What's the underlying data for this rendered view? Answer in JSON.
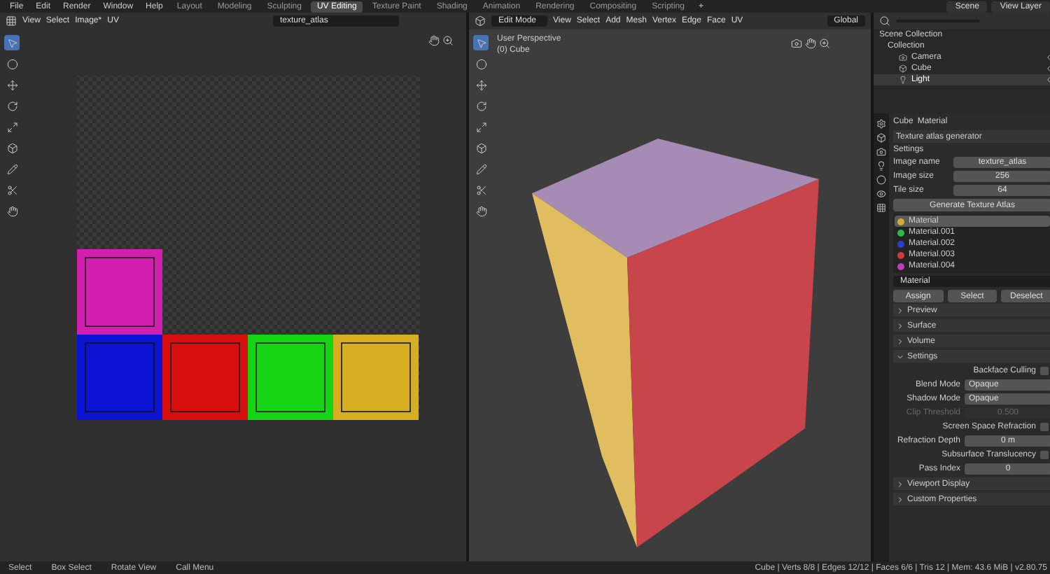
{
  "menu": [
    "File",
    "Edit",
    "Render",
    "Window",
    "Help"
  ],
  "workspaces": [
    {
      "label": "Layout",
      "selected": false
    },
    {
      "label": "Modeling",
      "selected": false
    },
    {
      "label": "Sculpting",
      "selected": false
    },
    {
      "label": "UV Editing",
      "selected": true
    },
    {
      "label": "Texture Paint",
      "selected": false
    },
    {
      "label": "Shading",
      "selected": false
    },
    {
      "label": "Animation",
      "selected": false
    },
    {
      "label": "Rendering",
      "selected": false
    },
    {
      "label": "Compositing",
      "selected": false
    },
    {
      "label": "Scripting",
      "selected": false
    }
  ],
  "add_workspace": "+",
  "scene": "Scene",
  "view_layer": "View Layer",
  "uv_editor": {
    "menus": [
      "View",
      "Select",
      "Image*",
      "UV"
    ],
    "image": "texture_atlas"
  },
  "viewport": {
    "mode": "Edit Mode",
    "menus": [
      "View",
      "Select",
      "Add",
      "Mesh",
      "Vertex",
      "Edge",
      "Face",
      "UV"
    ],
    "orientation": "Global",
    "perspective": "User Perspective",
    "object": "(0) Cube"
  },
  "outliner": {
    "root": "Scene Collection",
    "items": [
      {
        "label": "Collection",
        "children": [
          {
            "label": "Camera",
            "selected": false
          },
          {
            "label": "Cube",
            "selected": false
          },
          {
            "label": "Light",
            "selected": true
          }
        ]
      }
    ]
  },
  "properties": {
    "object": "Cube",
    "material": "Material",
    "panel": "Texture atlas generator",
    "subpanel": "Settings",
    "fields": [
      {
        "label": "Image name",
        "value": "texture_atlas"
      },
      {
        "label": "Image size",
        "value": "256"
      },
      {
        "label": "Tile size",
        "value": "64"
      }
    ],
    "generate": "Generate Texture Atlas",
    "slots": [
      {
        "name": "Material",
        "color": "#d4a93a",
        "selected": true
      },
      {
        "name": "Material.001",
        "color": "#2fb84a",
        "selected": false
      },
      {
        "name": "Material.002",
        "color": "#2a3fd0",
        "selected": false
      },
      {
        "name": "Material.003",
        "color": "#d03a3a",
        "selected": false
      },
      {
        "name": "Material.004",
        "color": "#c23ac0",
        "selected": false
      }
    ],
    "material_field": "Material",
    "actions": [
      "Assign",
      "Select",
      "Deselect"
    ],
    "sections": [
      {
        "label": "Preview",
        "expanded": false
      },
      {
        "label": "Surface",
        "expanded": false
      },
      {
        "label": "Volume",
        "expanded": false
      },
      {
        "label": "Settings",
        "expanded": true
      }
    ],
    "settings": [
      {
        "kind": "check",
        "label": "Backface Culling",
        "checked": false
      },
      {
        "kind": "select",
        "label": "Blend Mode",
        "value": "Opaque"
      },
      {
        "kind": "select",
        "label": "Shadow Mode",
        "value": "Opaque"
      },
      {
        "kind": "number",
        "label": "Clip Threshold",
        "value": "0.500",
        "disabled": true
      },
      {
        "kind": "check",
        "label": "Screen Space Refraction",
        "checked": false
      },
      {
        "kind": "number",
        "label": "Refraction Depth",
        "value": "0 m",
        "disabled": false
      },
      {
        "kind": "check",
        "label": "Subsurface Translucency",
        "checked": false
      },
      {
        "kind": "number",
        "label": "Pass Index",
        "value": "0",
        "disabled": false
      }
    ],
    "closed_sections": [
      {
        "label": "Viewport Display",
        "expanded": false
      },
      {
        "label": "Custom Properties",
        "expanded": false
      }
    ]
  },
  "status_bar": {
    "hints": [
      "Select",
      "Box Select",
      "Rotate View",
      "Call Menu"
    ],
    "stats": "Cube | Verts 8/8 | Edges 12/12 | Faces 6/6 | Tris 12 | Mem: 43.6 MiB | v2.80.75"
  }
}
